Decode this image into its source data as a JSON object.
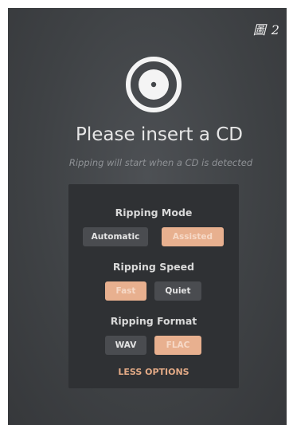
{
  "figure_label": "圖 2",
  "icon": "cd-disc-icon",
  "title": "Please insert a CD",
  "subtitle": "Ripping will start when a CD is detected",
  "colors": {
    "background": "#3f4245",
    "panel": "#2f3134",
    "accent": "#e8b08f",
    "button_inactive": "#4a4c50"
  },
  "options": {
    "ripping_mode": {
      "label": "Ripping Mode",
      "choices": [
        "Automatic",
        "Assisted"
      ],
      "selected": "Assisted"
    },
    "ripping_speed": {
      "label": "Ripping Speed",
      "choices": [
        "Fast",
        "Quiet"
      ],
      "selected": "Fast"
    },
    "ripping_format": {
      "label": "Ripping Format",
      "choices": [
        "WAV",
        "FLAC"
      ],
      "selected": "FLAC"
    },
    "less_options_label": "LESS OPTIONS"
  }
}
